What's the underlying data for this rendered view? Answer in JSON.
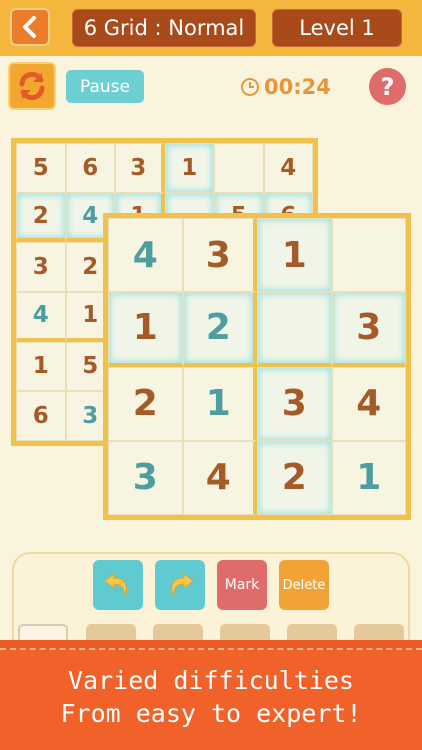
{
  "header": {
    "back_icon": "chevron-left-icon",
    "mode_label": "6 Grid : Normal",
    "level_label": "Level 1"
  },
  "controls": {
    "refresh_icon": "refresh-icon",
    "pause_label": "Pause",
    "timer_icon": "clock-icon",
    "timer": "00:24",
    "help_label": "?"
  },
  "board_six": {
    "size": 6,
    "cells": [
      [
        "5",
        "6",
        "3",
        "1",
        "",
        "4"
      ],
      [
        "2",
        "4",
        "1",
        "",
        "5",
        "6"
      ],
      [
        "3",
        "2",
        "",
        "",
        "",
        ""
      ],
      [
        "4",
        "1",
        "",
        "",
        "",
        ""
      ],
      [
        "1",
        "5",
        "",
        "",
        "",
        ""
      ],
      [
        "6",
        "3",
        "",
        "",
        "",
        ""
      ]
    ]
  },
  "board_four": {
    "size": 4,
    "cells": [
      [
        "4",
        "3",
        "1",
        ""
      ],
      [
        "1",
        "2",
        "",
        "3"
      ],
      [
        "2",
        "1",
        "3",
        "4"
      ],
      [
        "3",
        "4",
        "2",
        "1"
      ]
    ]
  },
  "toolbar": {
    "undo_icon": "undo-arrow-icon",
    "redo_icon": "redo-arrow-icon",
    "mark_label": "Mark",
    "delete_label": "Delete"
  },
  "banner": {
    "line1": "Varied difficulties",
    "line2": "From easy to expert!"
  },
  "colors": {
    "brown_digit": "#a55b27",
    "teal_digit": "#4e9da0",
    "accent_orange": "#f0622a",
    "board_border": "#f1c14e"
  }
}
